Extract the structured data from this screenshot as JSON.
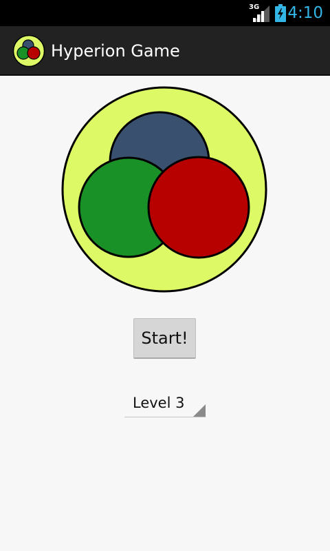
{
  "status_bar": {
    "network": "3G",
    "time": "4:10",
    "signal_icon": "signal-bars-icon",
    "battery_icon": "battery-charging-icon",
    "time_color": "#33b5e5"
  },
  "action_bar": {
    "title": "Hyperion Game",
    "icon": "hyperion-logo-icon"
  },
  "logo": {
    "colors": {
      "outer": "#ddf965",
      "blue": "#3a506f",
      "green": "#1a9127",
      "red": "#b70000"
    }
  },
  "main": {
    "start_label": "Start!",
    "level_selected": "Level 3"
  }
}
